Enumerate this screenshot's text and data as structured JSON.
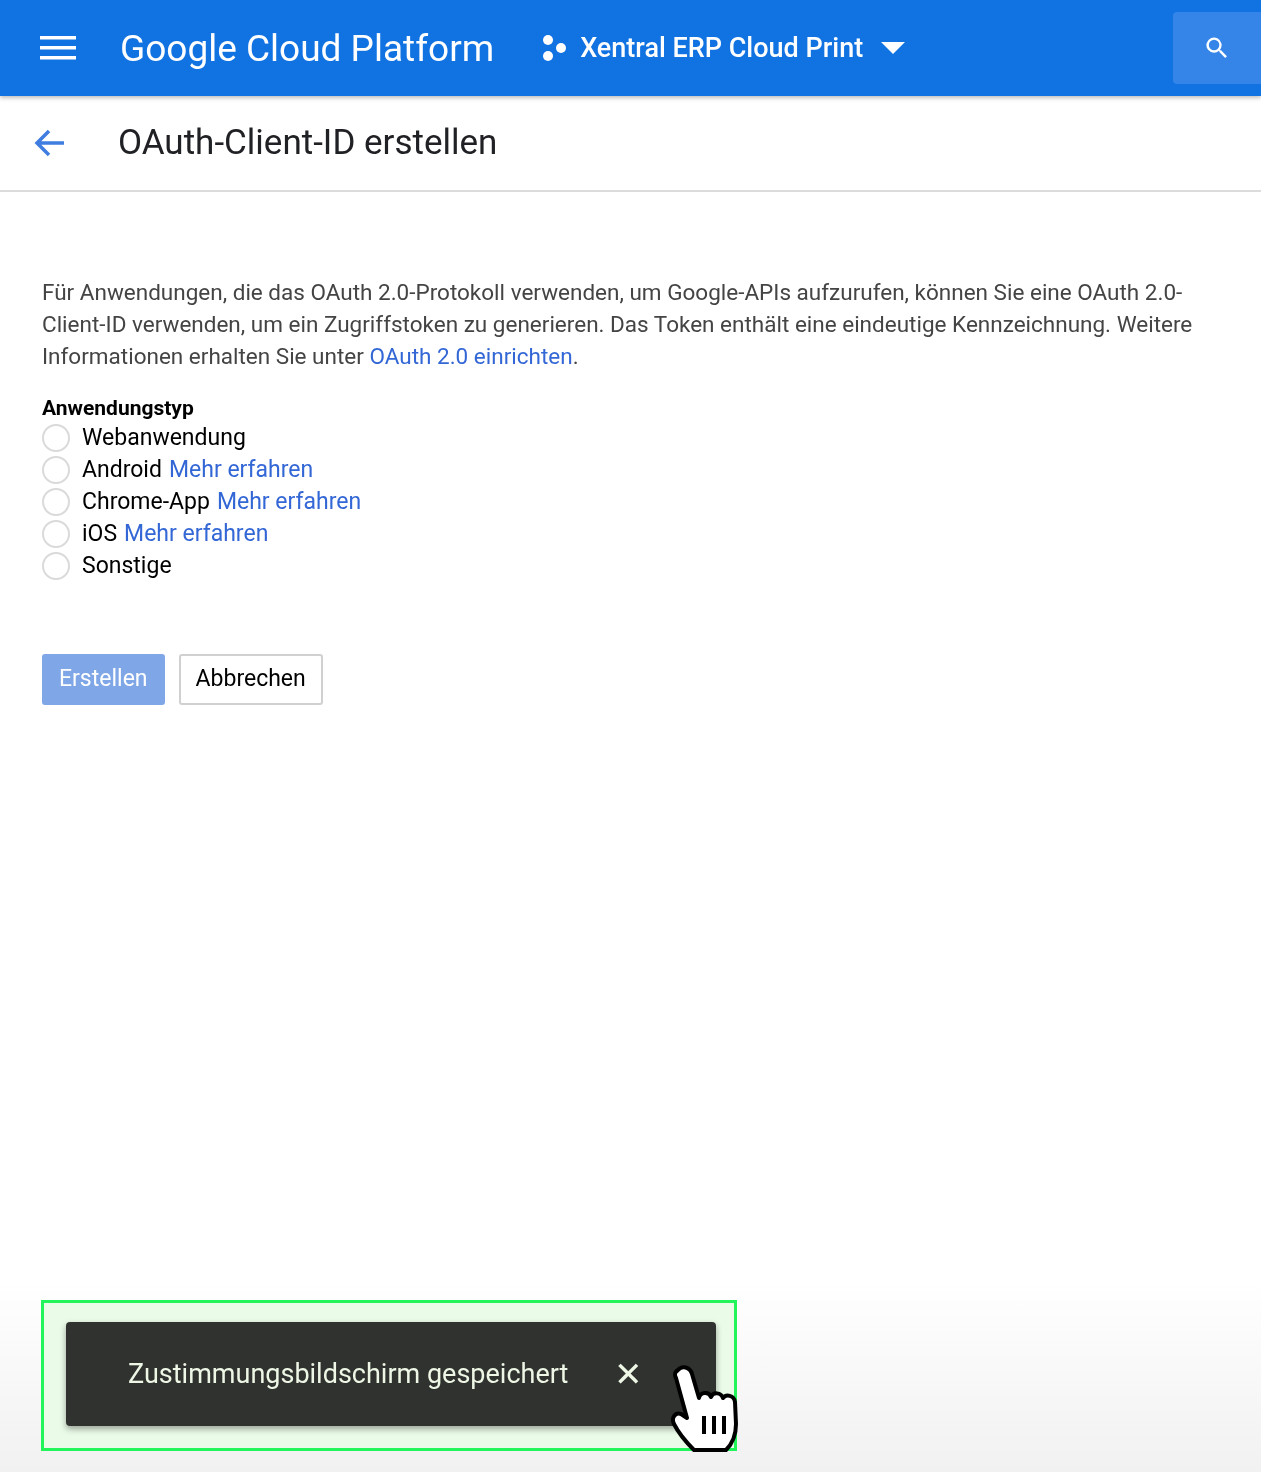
{
  "header": {
    "brand": "Google Cloud Platform",
    "project": "Xentral ERP Cloud Print"
  },
  "page": {
    "title": "OAuth-Client-ID erstellen"
  },
  "description": {
    "text": "Für Anwendungen, die das OAuth 2.0-Protokoll verwenden, um Google-APIs aufzurufen, können Sie eine OAuth 2.0-Client-ID verwenden, um ein Zugriffstoken zu generieren. Das Token enthält eine eindeutige Kennzeichnung. Weitere Informationen erhalten Sie unter ",
    "link": "OAuth 2.0 einrichten",
    "after": "."
  },
  "application_type": {
    "label": "Anwendungstyp",
    "options": [
      {
        "label": "Webanwendung",
        "selected": false
      },
      {
        "label": "Android",
        "link": "Mehr erfahren",
        "selected": false
      },
      {
        "label": "Chrome-App",
        "link": "Mehr erfahren",
        "selected": false
      },
      {
        "label": "iOS",
        "link": "Mehr erfahren",
        "selected": false
      },
      {
        "label": "Sonstige",
        "selected": false
      }
    ]
  },
  "buttons": [
    {
      "label": "Erstellen",
      "kind": "primary",
      "disabled": true
    },
    {
      "label": "Abbrechen",
      "kind": "secondary",
      "disabled": false
    }
  ],
  "snackbar": {
    "message": "Zustimmungsbildschirm gespeichert",
    "close": "✕"
  }
}
